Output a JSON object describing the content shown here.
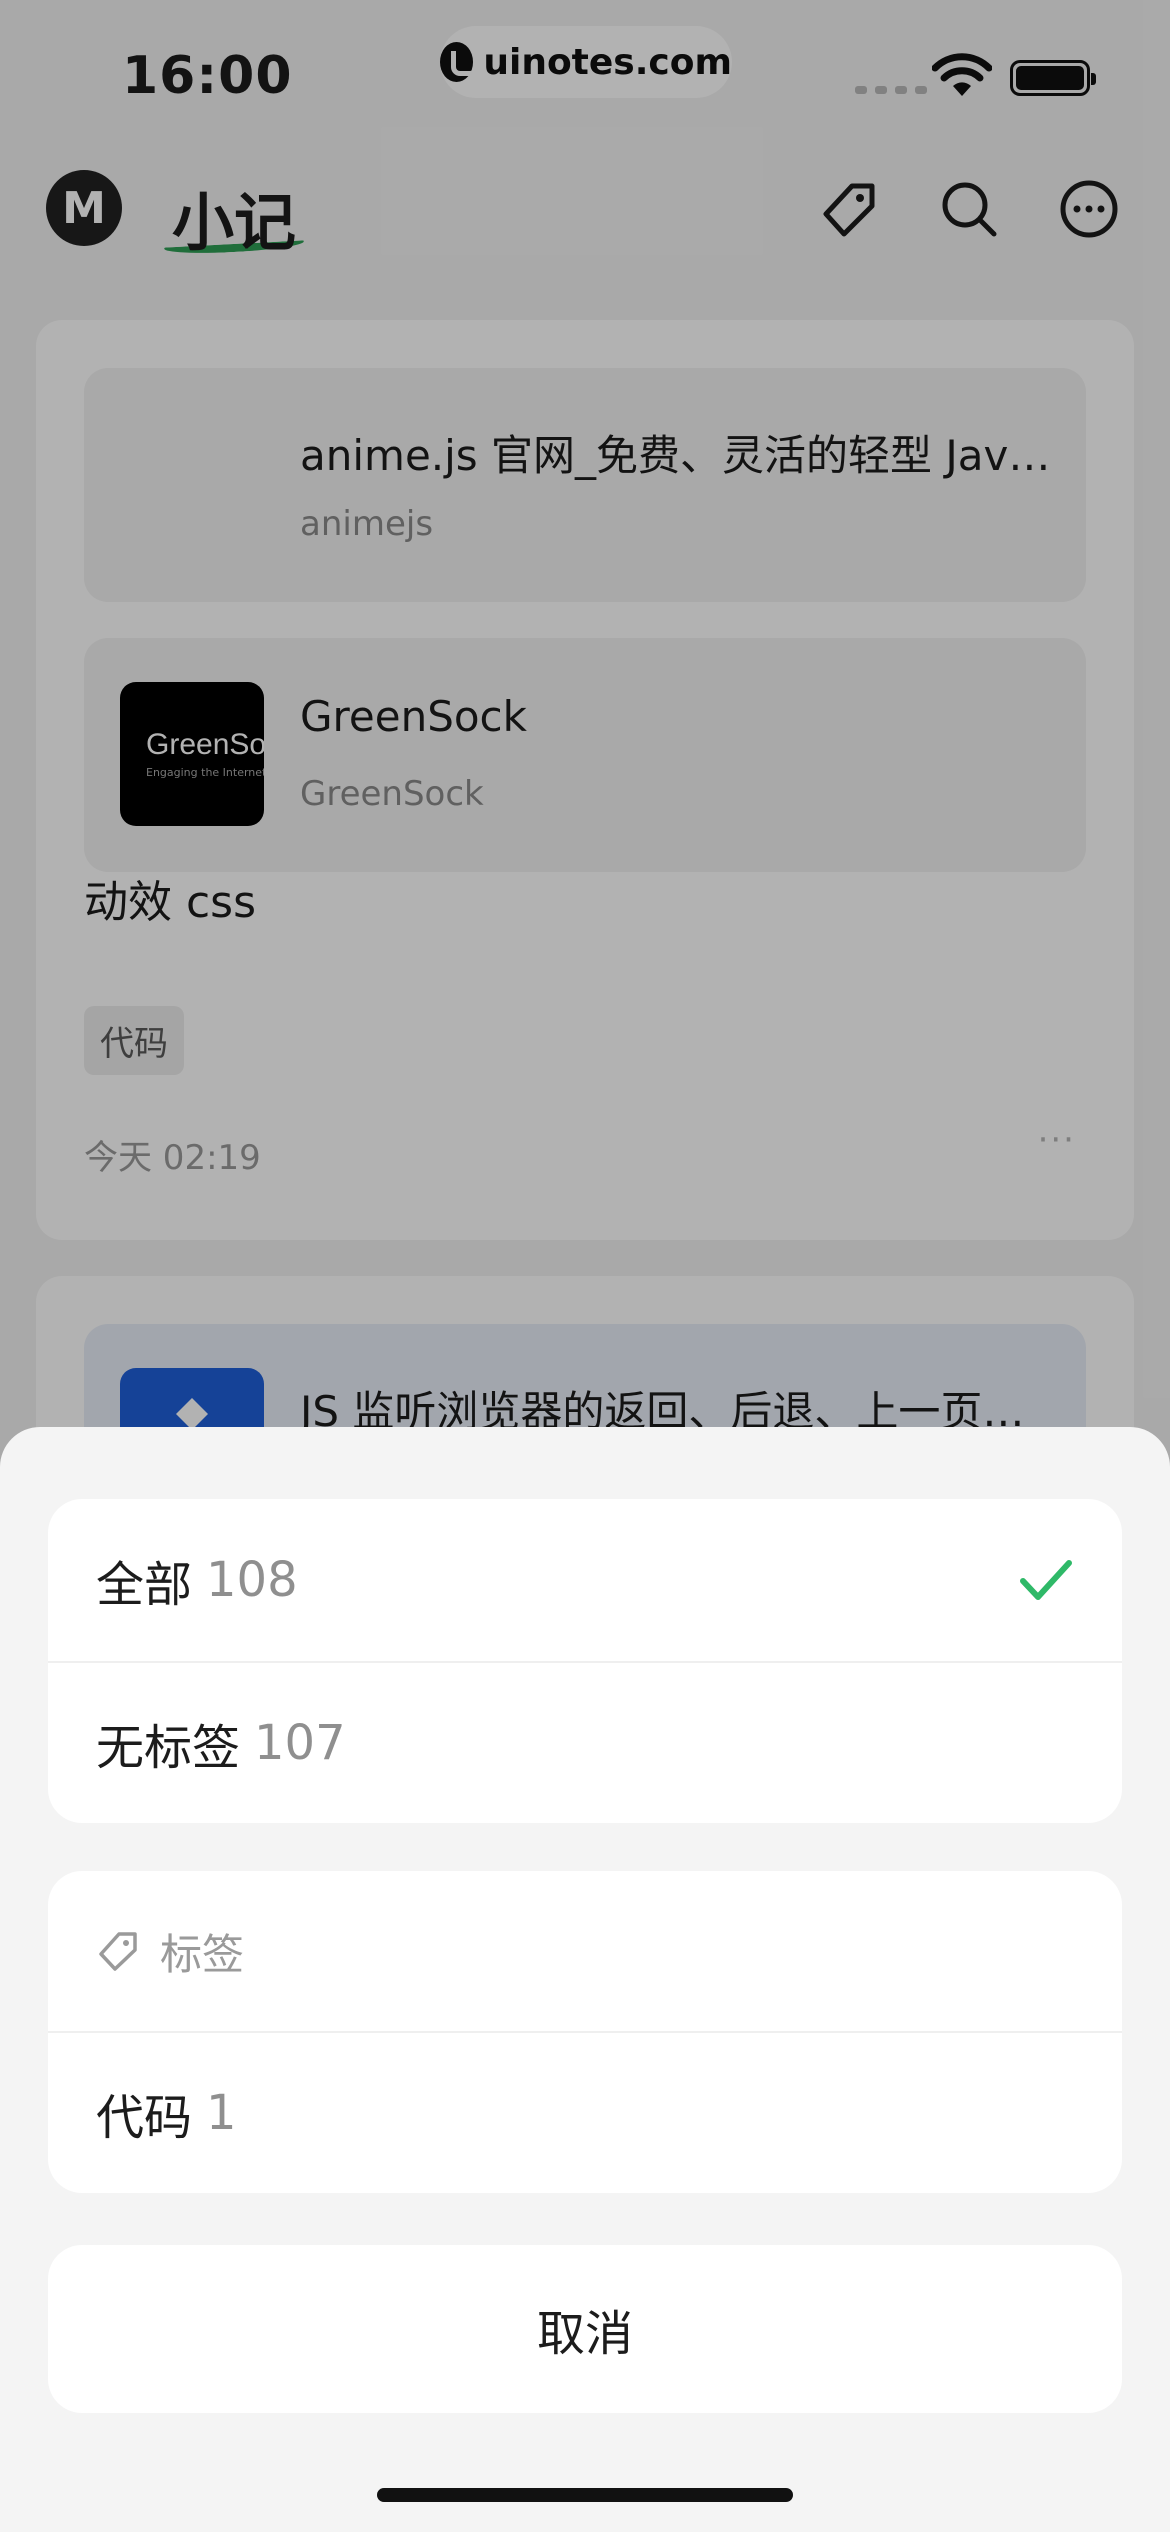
{
  "status_bar": {
    "time": "16:00",
    "badge_text": "uinotes.com"
  },
  "app_bar": {
    "logo_letter": "M",
    "title": "小记"
  },
  "notes": [
    {
      "links": [
        {
          "title": "anime.js 官网_免费、灵活的轻型 JavaScript 动画库",
          "site": "animejs"
        },
        {
          "title": "GreenSock",
          "site": "GreenSock",
          "thumb_text": "GreenSock",
          "thumb_subtext": "Engaging the Internet"
        }
      ],
      "text": "动效 css",
      "tag": "代码",
      "time": "今天 02:19",
      "more": "···"
    },
    {
      "links": [
        {
          "title": "JS 监听浏览器的返回、后退、上一页按钮的事件方法"
        }
      ]
    }
  ],
  "sheet": {
    "all_label": "全部",
    "all_count": "108",
    "untagged_label": "无标签",
    "untagged_count": "107",
    "tags_header": "标签",
    "tags": [
      {
        "label": "代码",
        "count": "1"
      }
    ],
    "cancel_label": "取消"
  },
  "colors": {
    "accent": "#2fb968",
    "title_underline": "#2e9e55",
    "dim": "rgba(0,0,0,0.30)"
  },
  "icons": [
    "tag-icon",
    "search-icon",
    "more-icon",
    "check-icon",
    "wifi-icon",
    "battery-icon"
  ]
}
